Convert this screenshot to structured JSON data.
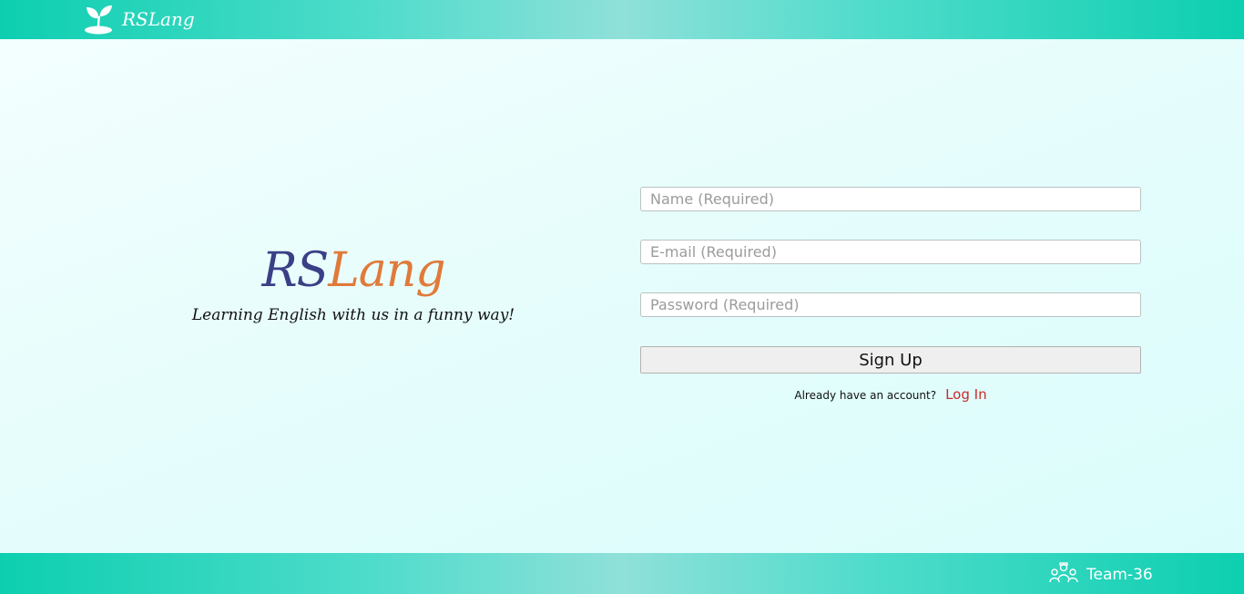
{
  "header": {
    "logo_text": "RSLang",
    "logo_icon": "sprout-icon"
  },
  "brand": {
    "title_rs": "RS",
    "title_lang": "Lang",
    "tagline": "Learning English with us in a funny way!"
  },
  "form": {
    "name_placeholder": "Name (Required)",
    "email_placeholder": "E-mail (Required)",
    "password_placeholder": "Password (Required)",
    "name_value": "",
    "email_value": "",
    "password_value": "",
    "submit_label": "Sign Up",
    "account_prompt": "Already have an account?",
    "login_link": "Log In"
  },
  "footer": {
    "team_label": "Team-36",
    "team_icon": "team-icon"
  },
  "colors": {
    "accent": "#0dcfb0",
    "brand_rs": "#3b3f86",
    "brand_lang": "#e07a3a",
    "link": "#cc2a2a"
  }
}
